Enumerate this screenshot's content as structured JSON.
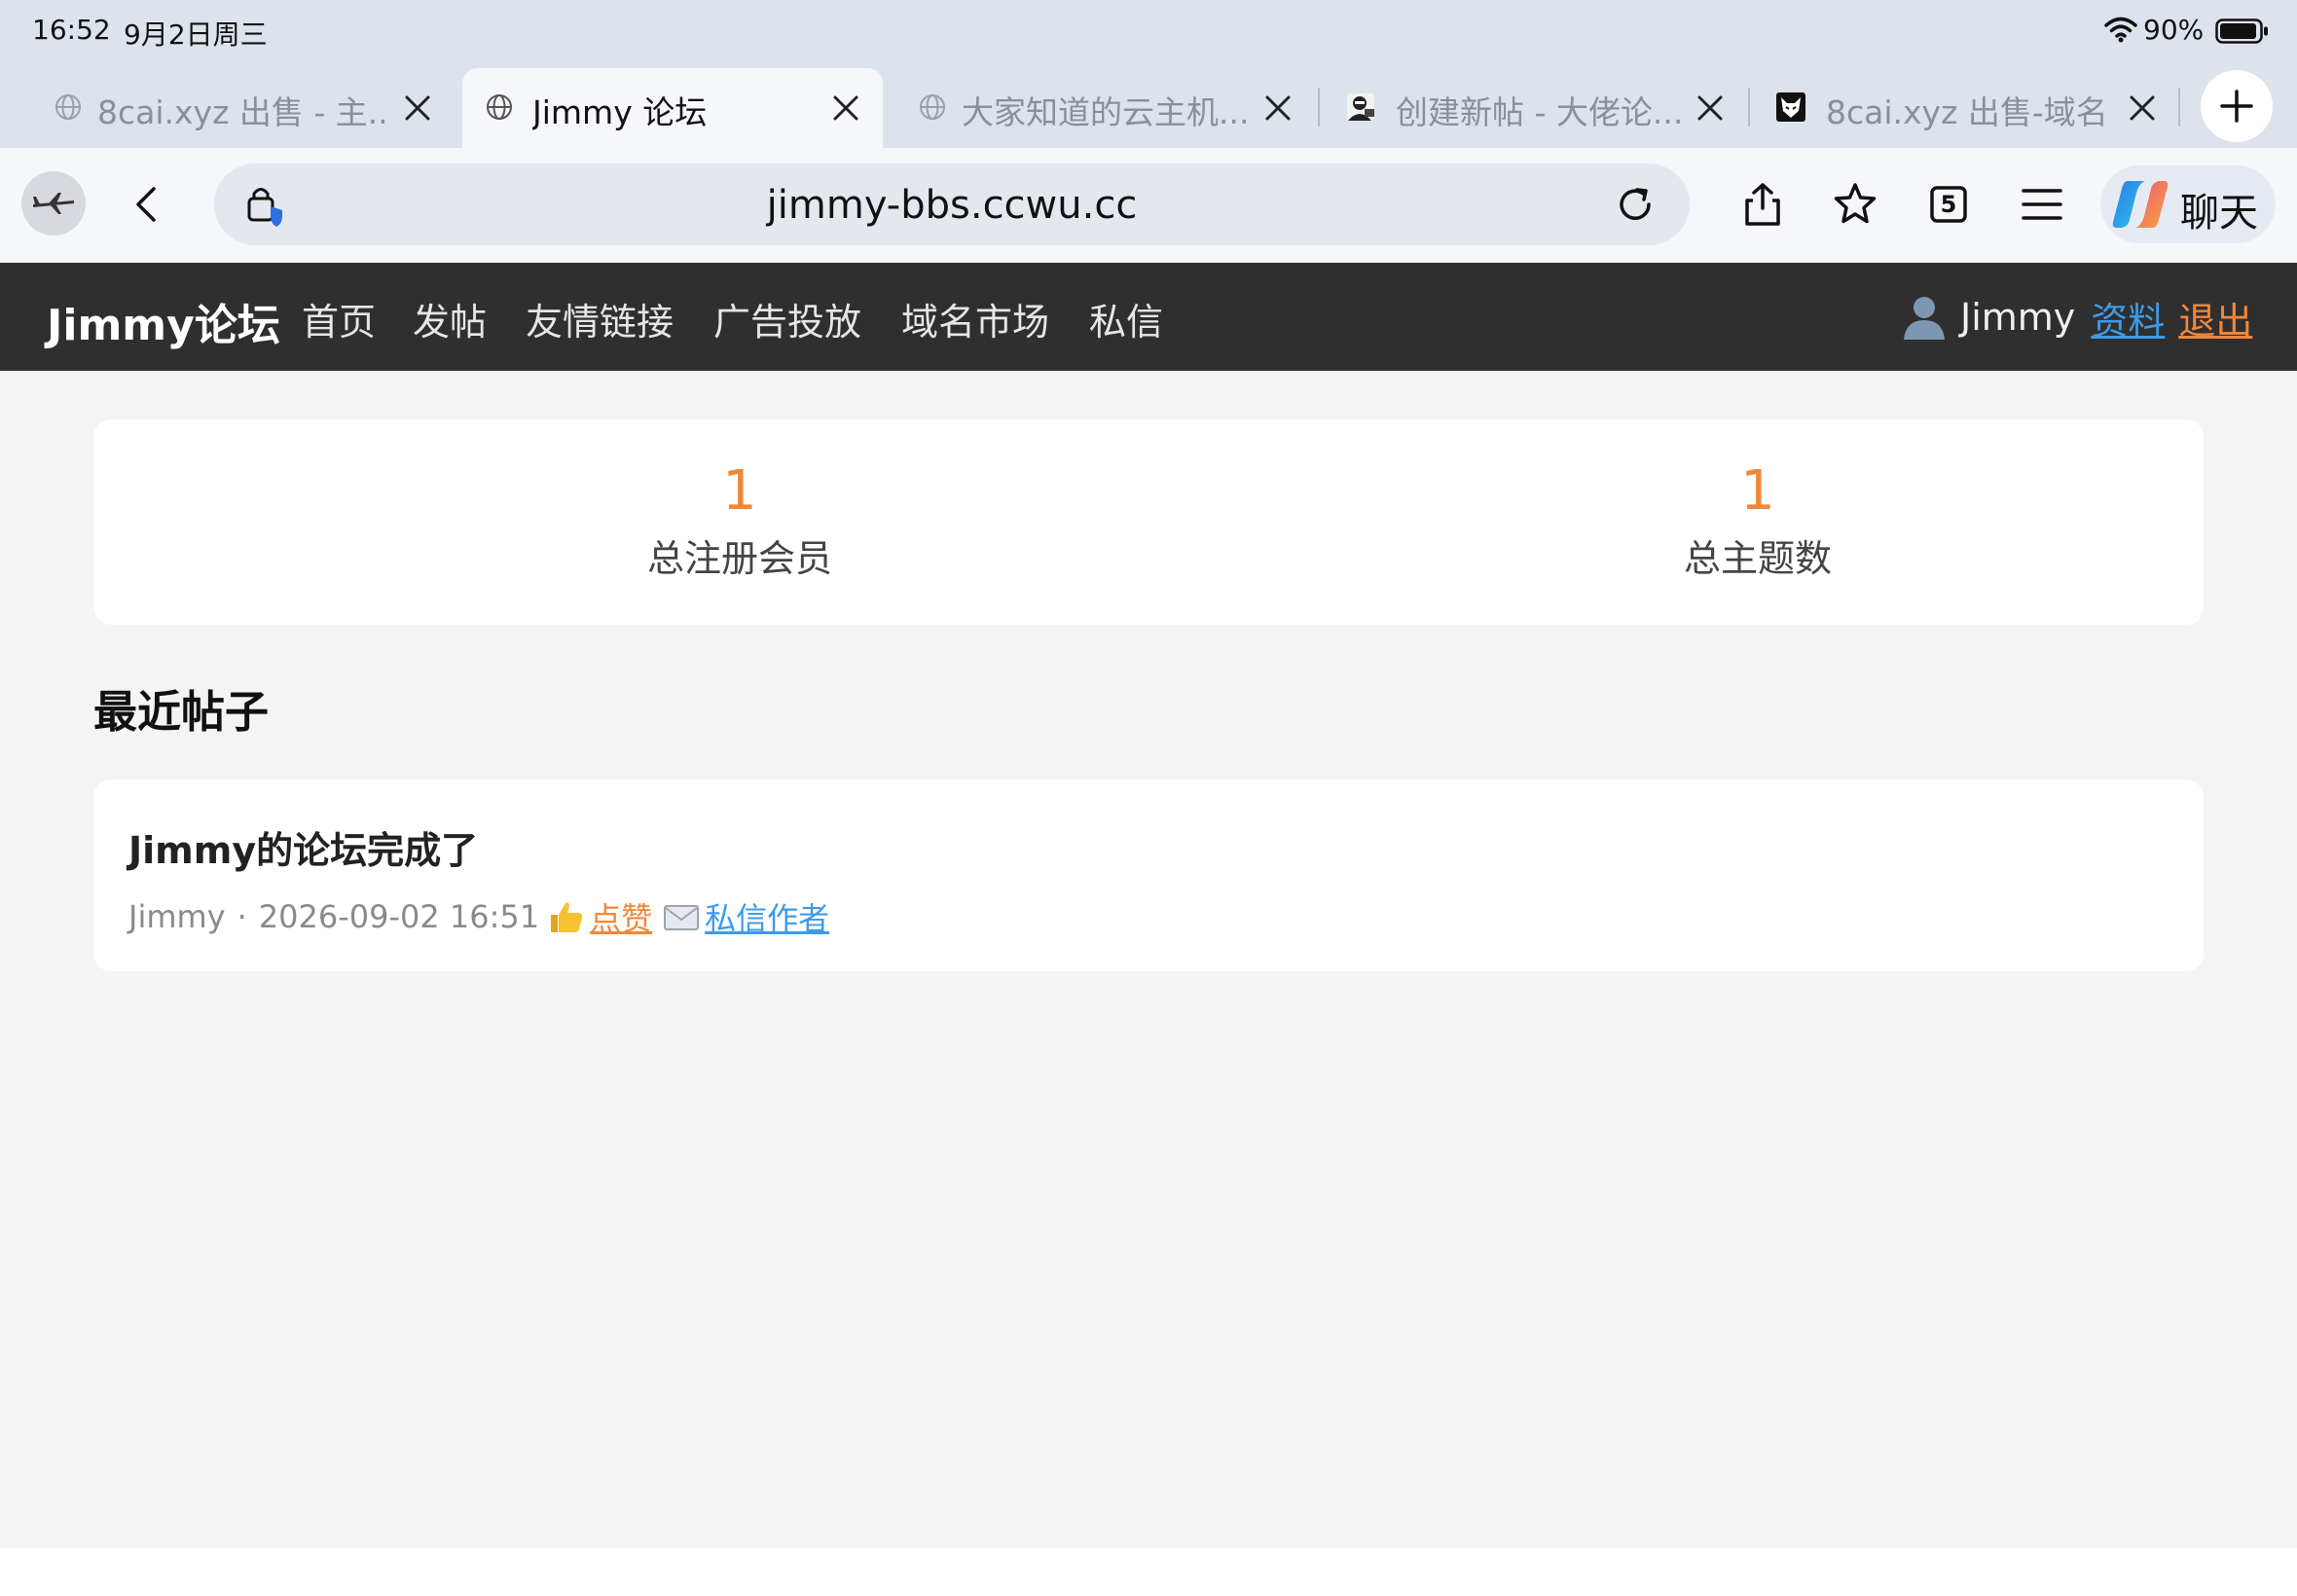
{
  "status_bar": {
    "time": "16:52",
    "date": "9月2日周三",
    "battery": "90%"
  },
  "tabs": [
    {
      "title": "8cai.xyz 出售 - 主...",
      "active": false,
      "favicon": "globe-icon"
    },
    {
      "title": "Jimmy 论坛",
      "active": true,
      "favicon": "globe-icon"
    },
    {
      "title": "大家知道的云主机...",
      "active": false,
      "favicon": "globe-icon"
    },
    {
      "title": "创建新帖 - 大佬论...",
      "active": false,
      "favicon": "hacker-avatar-icon"
    },
    {
      "title": "8cai.xyz 出售-域名",
      "active": false,
      "favicon": "wolf-logo-icon"
    }
  ],
  "toolbar": {
    "url": "jimmy-bbs.ccwu.cc",
    "tab_count": "5",
    "copilot_label": "聊天"
  },
  "site": {
    "logo": "Jimmy论坛",
    "nav": [
      "首页",
      "发帖",
      "友情链接",
      "广告投放",
      "域名市场",
      "私信"
    ],
    "user": {
      "name": "Jimmy",
      "profile_link": "资料",
      "logout_link": "退出"
    }
  },
  "stats": [
    {
      "value": "1",
      "label": "总注册会员"
    },
    {
      "value": "1",
      "label": "总主题数"
    }
  ],
  "recent": {
    "heading": "最近帖子",
    "posts": [
      {
        "title": "Jimmy的论坛完成了",
        "author": "Jimmy",
        "separator": "·",
        "time": "2026-09-02 16:51",
        "like_label": "点赞",
        "pm_label": "私信作者"
      }
    ]
  },
  "colors": {
    "accent_orange": "#f0883a",
    "link_blue": "#3d9be9",
    "nav_bg": "#2f2f2f"
  }
}
